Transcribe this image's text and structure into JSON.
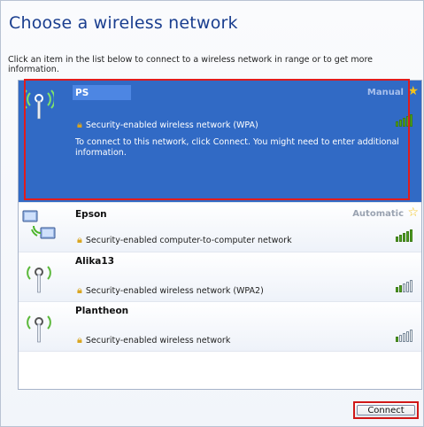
{
  "window": {
    "title": "Choose a wireless network",
    "instructions": "Click an item in the list below to connect to a wireless network in range or to get more information."
  },
  "networks": [
    {
      "name": "PS",
      "mode": "Manual",
      "security": "Security-enabled wireless network (WPA)",
      "description": "To connect to this network, click Connect. You might need to enter additional information.",
      "signal_bars_on": 5,
      "icon": "antenna-icon",
      "selected": true
    },
    {
      "name": "Epson",
      "mode": "Automatic",
      "security": "Security-enabled computer-to-computer network",
      "signal_bars_on": 5,
      "icon": "computer-to-computer-icon",
      "selected": false
    },
    {
      "name": "Alika13",
      "mode": "",
      "security": "Security-enabled wireless network (WPA2)",
      "signal_bars_on": 2,
      "icon": "antenna-icon",
      "selected": false
    },
    {
      "name": "Plantheon",
      "mode": "",
      "security": "Security-enabled wireless network",
      "signal_bars_on": 1,
      "icon": "antenna-icon",
      "selected": false
    }
  ],
  "buttons": {
    "connect_label": "Connect"
  },
  "colors": {
    "selection": "#316ac5",
    "title": "#1a3e8f",
    "highlight_border": "#e01c1c"
  }
}
